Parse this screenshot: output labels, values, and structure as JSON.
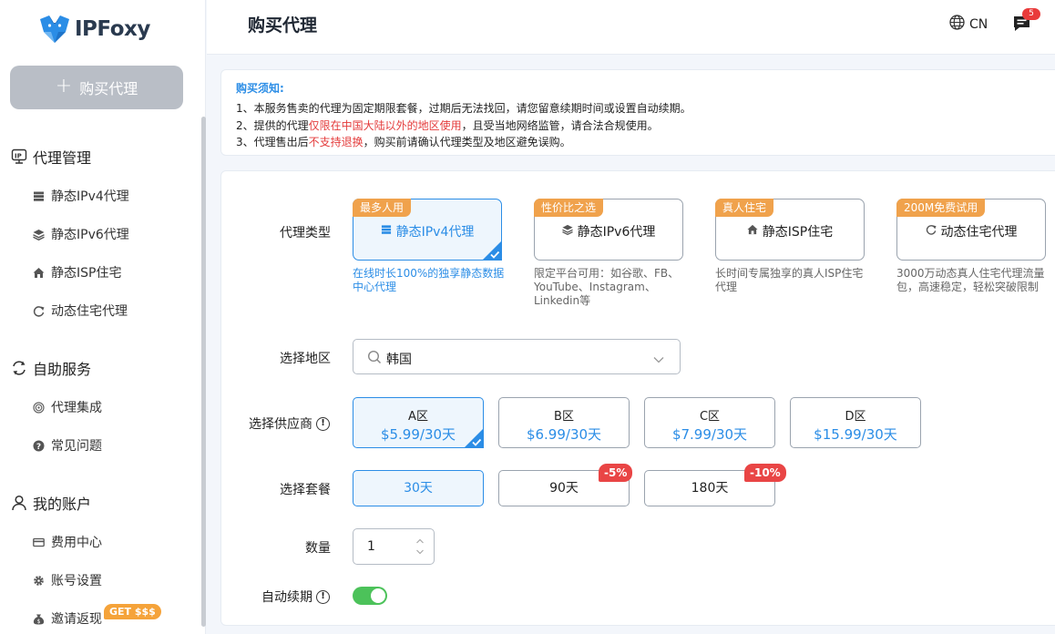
{
  "brand": {
    "name": "IPFoxy"
  },
  "sidebar": {
    "buy_button": "购买代理",
    "groups": [
      {
        "label": "代理管理",
        "icon": "ip-icon"
      },
      {
        "label": "自助服务",
        "icon": "sync-icon"
      },
      {
        "label": "我的账户",
        "icon": "user-icon"
      }
    ],
    "items": [
      {
        "label": "静态IPv4代理",
        "icon": "server-icon"
      },
      {
        "label": "静态IPv6代理",
        "icon": "layers-icon"
      },
      {
        "label": "静态ISP住宅",
        "icon": "house-icon"
      },
      {
        "label": "动态住宅代理",
        "icon": "rotate-icon"
      },
      {
        "label": "代理集成",
        "icon": "fingerprint-icon"
      },
      {
        "label": "常见问题",
        "icon": "question-icon"
      },
      {
        "label": "费用中心",
        "icon": "card-icon"
      },
      {
        "label": "账号设置",
        "icon": "gear-icon"
      },
      {
        "label": "邀请返现",
        "icon": "moneybag-icon"
      }
    ],
    "invite_badge": "GET $$$"
  },
  "header": {
    "title": "购买代理",
    "lang": "CN",
    "message_count": "5"
  },
  "notice": {
    "title": "购买须知:",
    "line1": "1、本服务售卖的代理为固定期限套餐，过期后无法找回，请您留意续期时间或设置自动续期。",
    "line2_a": "2、提供的代理",
    "line2_red": "仅限在中国大陆以外的地区使用",
    "line2_b": "，且受当地网络监管，请合法合规使用。",
    "line3_a": "3、代理售出后",
    "line3_red": "不支持退换",
    "line3_b": "，购买前请确认代理类型及地区避免误购。"
  },
  "form": {
    "type_label": "代理类型",
    "region_label": "选择地区",
    "supplier_label": "选择供应商",
    "plan_label": "选择套餐",
    "quantity_label": "数量",
    "autorenew_label": "自动续期",
    "proxy_types": [
      {
        "tag": "最多人用",
        "name": "静态IPv4代理",
        "desc": "在线时长100%的独享静态数据中心代理",
        "selected": true
      },
      {
        "tag": "性价比之选",
        "name": "静态IPv6代理",
        "desc": "限定平台可用：如谷歌、FB、YouTube、Instagram、Linkedin等",
        "selected": false
      },
      {
        "tag": "真人住宅",
        "name": "静态ISP住宅",
        "desc": "长时间专属独享的真人ISP住宅代理",
        "selected": false
      },
      {
        "tag": "200M免费试用",
        "name": "动态住宅代理",
        "desc": "3000万动态真人住宅代理流量包，高速稳定，轻松突破限制",
        "selected": false
      }
    ],
    "region_value": "韩国",
    "suppliers": [
      {
        "zone": "A区",
        "price": "$5.99/30天",
        "selected": true
      },
      {
        "zone": "B区",
        "price": "$6.99/30天",
        "selected": false
      },
      {
        "zone": "C区",
        "price": "$7.99/30天",
        "selected": false
      },
      {
        "zone": "D区",
        "price": "$15.99/30天",
        "selected": false
      }
    ],
    "plans": [
      {
        "label": "30天",
        "discount": "",
        "selected": true
      },
      {
        "label": "90天",
        "discount": "-5%",
        "selected": false
      },
      {
        "label": "180天",
        "discount": "-10%",
        "selected": false
      }
    ],
    "quantity": "1",
    "autorenew_on": true
  },
  "colors": {
    "accent": "#2b8de6",
    "tag": "#f0a24c",
    "danger": "#e94545",
    "toggle": "#4cc25a"
  }
}
